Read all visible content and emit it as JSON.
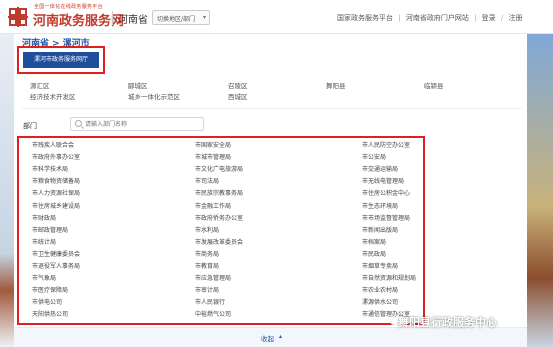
{
  "header": {
    "logo_small": "全国一体化在线政务服务平台",
    "logo_title": "河南政务服务网",
    "province": "河南省",
    "region_select": "切换地区/部门",
    "links": [
      "国家政务服务平台",
      "|",
      "河南省政府门户网站",
      "|",
      "登录",
      "/",
      "注册"
    ]
  },
  "breadcrumb": {
    "province": "河南省",
    "sep": ">",
    "city": "漯河市"
  },
  "city_hall_button": "漯河市政务服务网厅",
  "counties": [
    [
      "源汇区",
      "郾城区",
      "召陵区",
      "舞阳县",
      "临颍县"
    ],
    [
      "经济技术开发区",
      "城乡一体化示范区",
      "西城区"
    ]
  ],
  "dept_label": "部门",
  "dept_search_placeholder": "请输入部门名称",
  "departments": [
    [
      "市残疾人联合会",
      "市国家安全局",
      "市人民防空办公室"
    ],
    [
      "市政府外事办公室",
      "市城市管理局",
      "市公安局"
    ],
    [
      "市科学技术局",
      "市文化广电旅游局",
      "市交通运输局"
    ],
    [
      "市粮食物资储备局",
      "市司法局",
      "市无线电管理局"
    ],
    [
      "市人力资源社保局",
      "市民族宗教事务局",
      "市住房公积金中心"
    ],
    [
      "市住房城乡建设局",
      "市金融工作局",
      "市生态环境局"
    ],
    [
      "市财政局",
      "市政府侨务办公室",
      "市市场监督管理局"
    ],
    [
      "市邮政管理局",
      "市水利局",
      "市新闻出版局"
    ],
    [
      "市统计局",
      "市发展改革委员会",
      "市档案局"
    ],
    [
      "市卫生健康委员会",
      "市商务局",
      "市民政局"
    ],
    [
      "市退役军人事务局",
      "市教育局",
      "市烟草专卖局"
    ],
    [
      "市气象局",
      "市应急管理局",
      "市自然资源和规划局"
    ],
    [
      "市医疗保障局",
      "市审计局",
      "市农业农村局"
    ],
    [
      "市供电公司",
      "市人民银行",
      "漯源供水公司"
    ],
    [
      "天阳供热公司",
      "中裕燃气公司",
      "市通信管理办公室"
    ]
  ],
  "collapse_label": "收起",
  "watermark": "舞阳县行政服务中心",
  "colors": {
    "accent": "#1e5aa8",
    "brand_red": "#c0392b",
    "highlight": "#e02020",
    "button_bg": "#1f4e9c"
  }
}
